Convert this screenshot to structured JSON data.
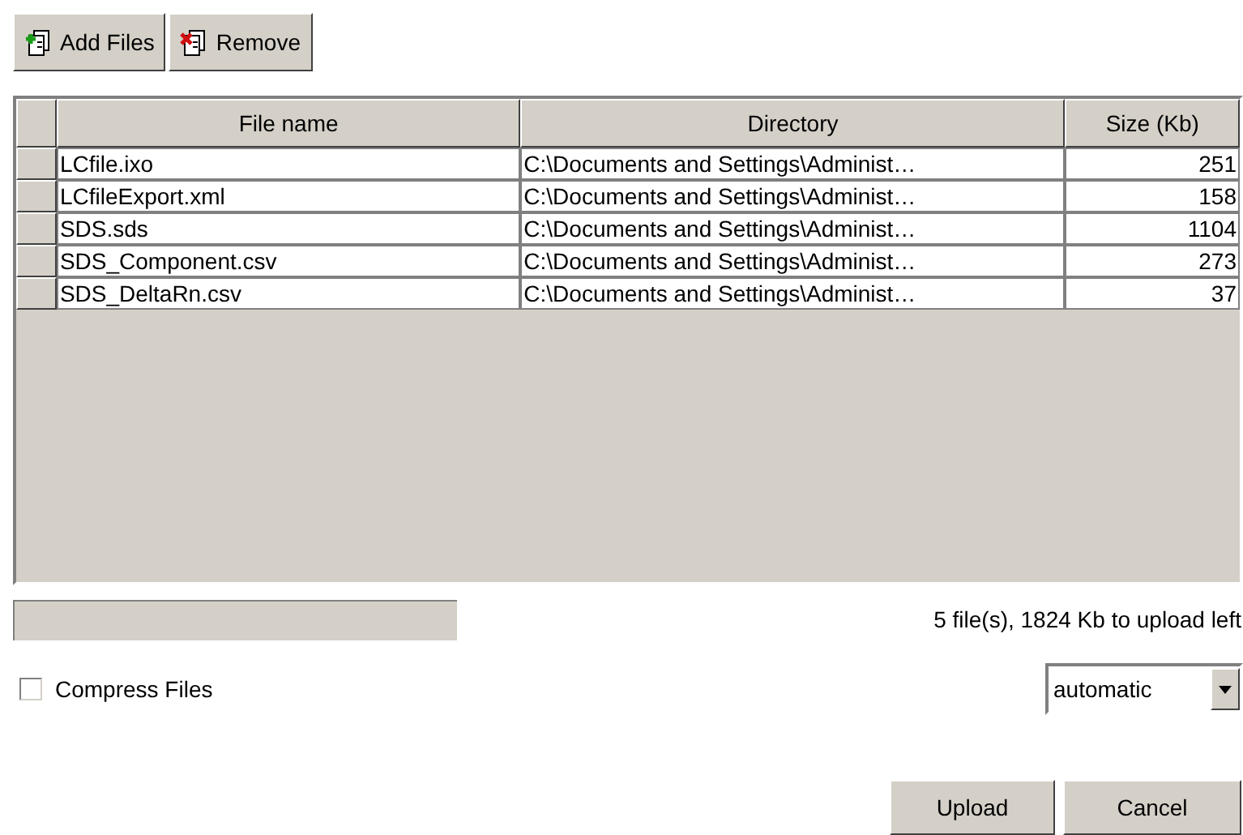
{
  "toolbar": [
    {
      "kind": "add",
      "label": "Add Files"
    },
    {
      "kind": "remove",
      "label": "Remove"
    }
  ],
  "table": {
    "columns": [
      "File name",
      "Directory",
      "Size (Kb)"
    ],
    "rows": [
      [
        "LCfile.ixo",
        "C:\\Documents and Settings\\Administ…",
        "251"
      ],
      [
        "LCfileExport.xml",
        "C:\\Documents and Settings\\Administ…",
        "158"
      ],
      [
        "SDS.sds",
        "C:\\Documents and Settings\\Administ…",
        "1104"
      ],
      [
        "SDS_Component.csv",
        "C:\\Documents and Settings\\Administ…",
        "273"
      ],
      [
        "SDS_DeltaRn.csv",
        "C:\\Documents and Settings\\Administ…",
        "37"
      ]
    ]
  },
  "progress": {
    "level": 0
  },
  "status": "5 file(s), 1824 Kb to upload left",
  "compress": {
    "label": "Compress Files",
    "checked": false
  },
  "mode_select": {
    "value": "automatic"
  },
  "buttons": [
    "Upload",
    "Cancel"
  ]
}
